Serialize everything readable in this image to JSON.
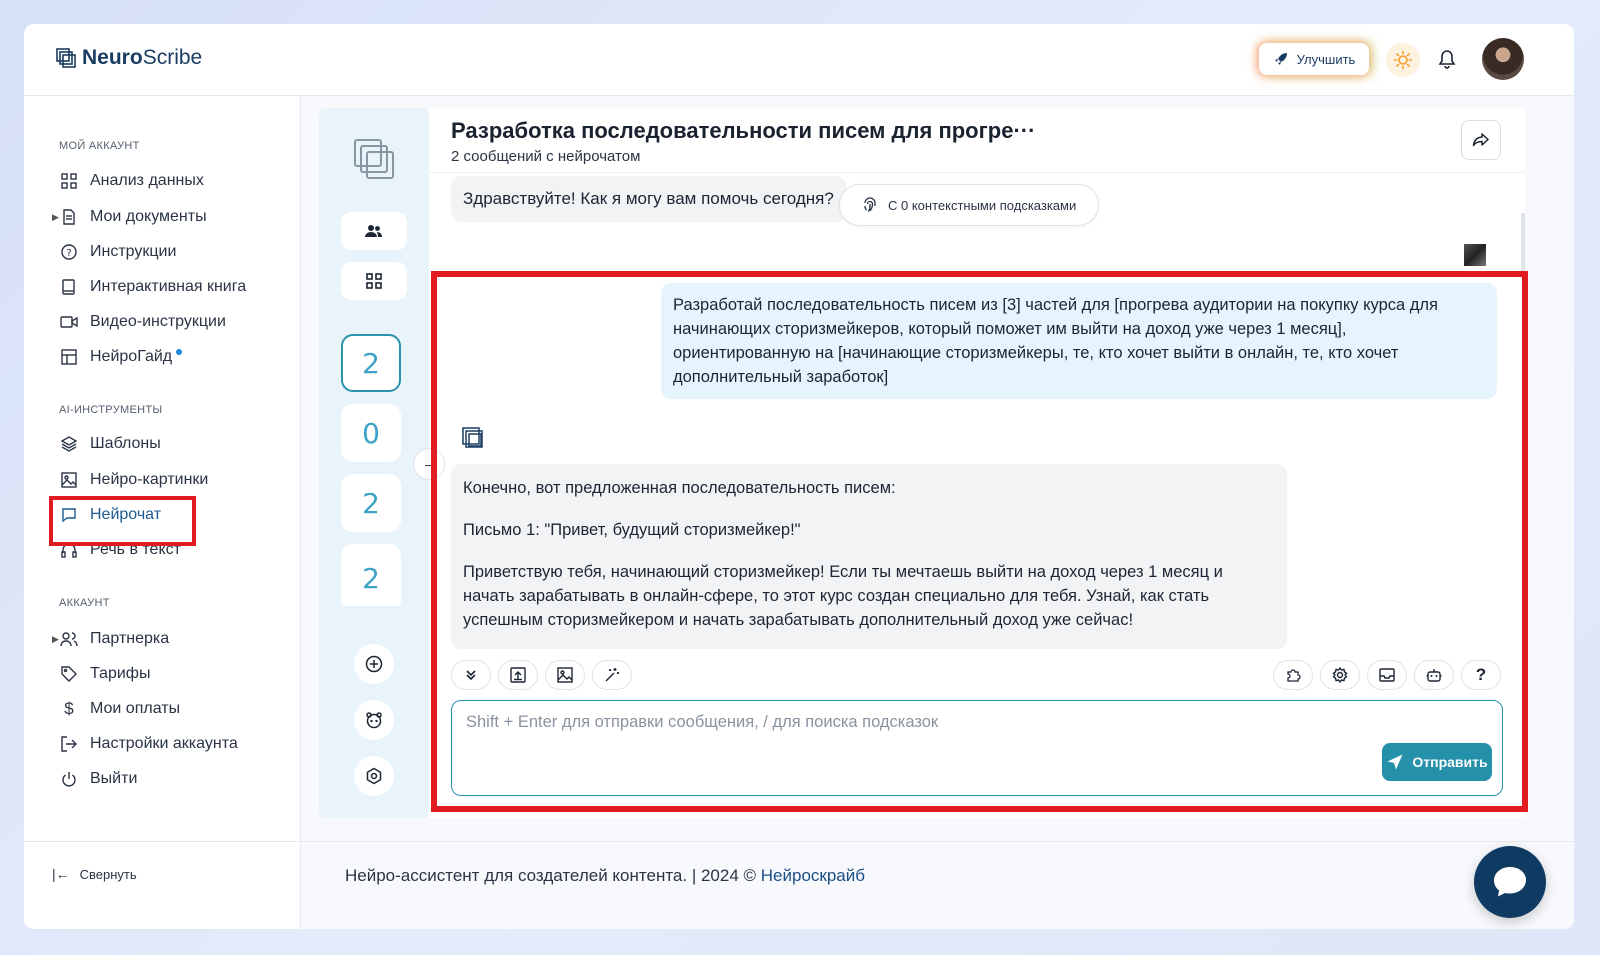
{
  "header": {
    "brand_bold": "Neuro",
    "brand_light": "Scribe",
    "upgrade_label": "Улучшить"
  },
  "sidebar": {
    "section_account": "Мой аккаунт",
    "section_ai": "AI-инструменты",
    "section_acc2": "Аккаунт",
    "items": {
      "analysis": "Анализ данных",
      "docs": "Мои документы",
      "instructions": "Инструкции",
      "book": "Интерактивная книга",
      "video": "Видео-инструкции",
      "guide": "НейроГайд",
      "templates": "Шаблоны",
      "images": "Нейро-картинки",
      "chat": "Нейрочат",
      "speech": "Речь в текст",
      "partner": "Партнерка",
      "tariffs": "Тарифы",
      "payments": "Мои оплаты",
      "settings": "Настройки аккаунта",
      "logout": "Выйти"
    },
    "collapse_label": "Свернуть"
  },
  "left_panel": {
    "counts": [
      "2",
      "0",
      "2",
      "2"
    ]
  },
  "chat": {
    "title": "Разработка последовательности писем для прогре···",
    "subtitle": "2 сообщений с нейрочатом",
    "greeting": "Здравствуйте! Как я могу вам помочь сегодня?",
    "context_chip": "С 0 контекстными подсказками",
    "user_message": "Разработай последовательность писем из [3] частей для [прогрева аудитории на покупку курса для начинающих сторизмейкеров, который поможет им выйти на доход уже через 1 месяц], ориентированную на [начинающие сторизмейкеры, те, кто хочет выйти в онлайн, те, кто хочет дополнительный заработок]",
    "bot_p1": "Конечно, вот предложенная последовательность писем:",
    "bot_p2": "Письмо 1: \"Привет, будущий сторизмейкер!\"",
    "bot_p3": "Приветствую тебя, начинающий сторизмейкер! Если ты мечтаешь выйти на доход через 1 месяц и начать зарабатывать в онлайн-сфере, то этот курс создан специально для тебя. Узнай, как стать успешным сторизмейкером и начать зарабатывать дополнительный доход уже сейчас!",
    "input_placeholder": "Shift + Enter для отправки сообщения, / для поиска подсказок",
    "send_label": "Отправить",
    "help_label": "?"
  },
  "footer": {
    "text": "Нейро-ассистент для создателей контента.  | 2024 © ",
    "link": "Нейроскрайб"
  },
  "colors": {
    "accent": "#2590aa",
    "highlight": "#e11b22",
    "brand": "#1c3d63"
  }
}
